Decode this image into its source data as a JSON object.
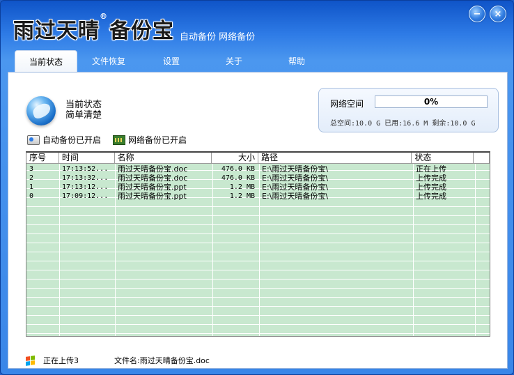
{
  "app": {
    "logo_main": "雨过天晴",
    "logo_reg": "®",
    "logo_sub": "备份宝",
    "slogan": "自动备份 网络备份",
    "minimize_glyph": "−",
    "close_glyph": "×"
  },
  "tabs": [
    {
      "label": "当前状态",
      "active": true
    },
    {
      "label": "文件恢复",
      "active": false
    },
    {
      "label": "设置",
      "active": false
    },
    {
      "label": "关于",
      "active": false
    },
    {
      "label": "帮助",
      "active": false
    }
  ],
  "status": {
    "icon": "globe-icon",
    "title": "当前状态",
    "subtitle": "简单清楚"
  },
  "network_space": {
    "label": "网络空间",
    "progress_percent": 0,
    "progress_text": "0%",
    "info": "总空间:10.0 G 已用:16.6 M 剩余:10.0 G"
  },
  "indicators": {
    "auto_backup": "自动备份已开启",
    "network_backup": "网络备份已开启"
  },
  "table": {
    "columns": [
      "序号",
      "时间",
      "名称",
      "大小",
      "路径",
      "状态"
    ],
    "rows": [
      {
        "no": "3",
        "time": "17:13:52...",
        "name": "雨过天晴备份宝.doc",
        "size": "476.0 KB",
        "path": "E:\\雨过天晴备份宝\\",
        "state": "正在上传"
      },
      {
        "no": "2",
        "time": "17:13:32...",
        "name": "雨过天晴备份宝.doc",
        "size": "476.0 KB",
        "path": "E:\\雨过天晴备份宝\\",
        "state": "上传完成"
      },
      {
        "no": "1",
        "time": "17:13:12...",
        "name": "雨过天晴备份宝.ppt",
        "size": "1.2 MB",
        "path": "E:\\雨过天晴备份宝\\",
        "state": "上传完成"
      },
      {
        "no": "0",
        "time": "17:09:12...",
        "name": "雨过天晴备份宝.ppt",
        "size": "1.2 MB",
        "path": "E:\\雨过天晴备份宝\\",
        "state": "上传完成"
      }
    ]
  },
  "statusbar": {
    "uploading": "正在上传3",
    "filename": "文件名:雨过天晴备份宝.doc"
  },
  "colors": {
    "title_bar": "#2e7be6",
    "table_row": "#c8e8cf",
    "progress_fill": "#3b8ae8"
  }
}
